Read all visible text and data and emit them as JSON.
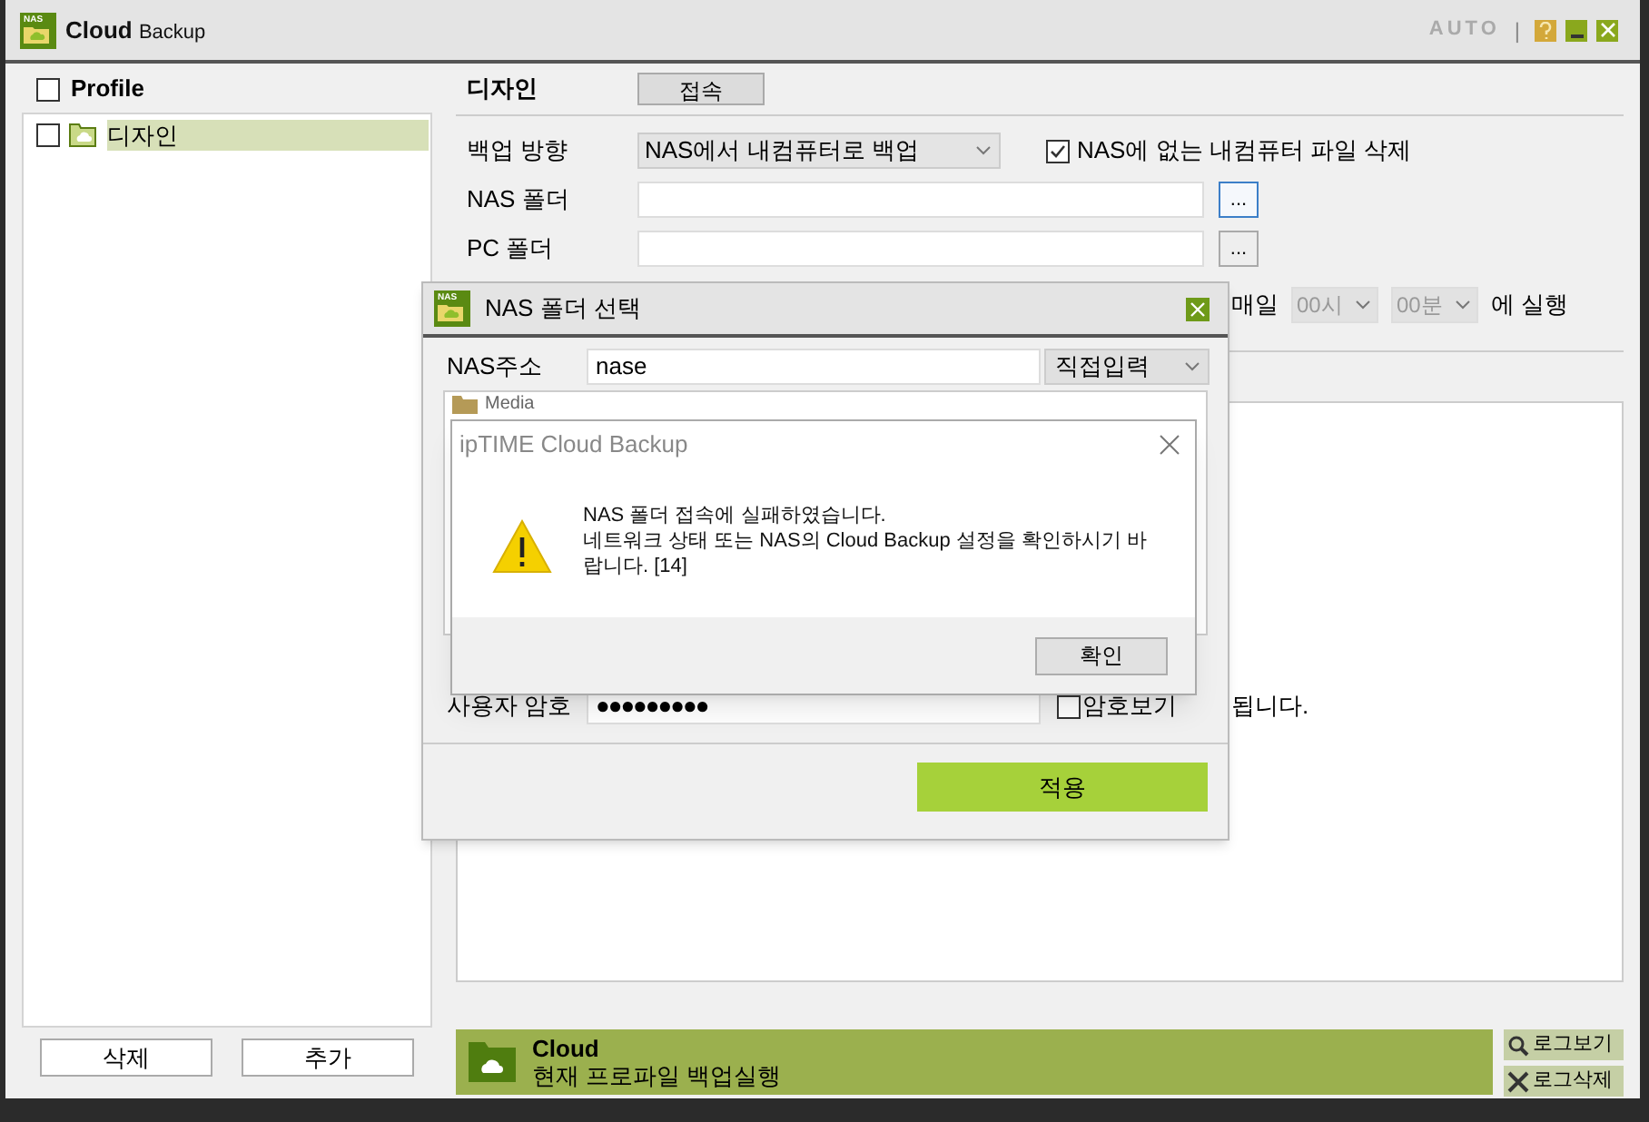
{
  "window": {
    "logo_text": "NAS",
    "title_bold": "Cloud",
    "title_rest": "Backup",
    "auto_label": "AUTO",
    "separator": "|"
  },
  "profiles": {
    "header": "Profile",
    "header_checked": false,
    "items": [
      {
        "label": "디자인",
        "checked": false,
        "selected": true
      }
    ],
    "buttons": [
      "삭제",
      "추가"
    ]
  },
  "detail": {
    "name": "디자인",
    "connect_button": "접속",
    "direction_label": "백업 방향",
    "direction_value": "NAS에서 내컴퓨터로 백업",
    "delete_option": {
      "label": "NAS에 없는 내컴퓨터 파일 삭제",
      "checked": true
    },
    "nas_folder_label": "NAS 폴더",
    "pc_folder_label": "PC 폴더",
    "browse_button": "...",
    "schedule": {
      "every_label": "매일",
      "hour": "00시",
      "minute": "00분",
      "suffix": "에 실행"
    },
    "log_fragment": "됩니다."
  },
  "status_bar": {
    "title": "Cloud",
    "subtitle": "현재 프로파일 백업실행",
    "buttons": [
      {
        "kind": "view",
        "label": "로그보기"
      },
      {
        "kind": "delete",
        "label": "로그삭제"
      }
    ]
  },
  "nas_dialog": {
    "logo_text": "NAS",
    "title": "NAS 폴더 선택",
    "address_label": "NAS주소",
    "address_value": "nase",
    "address_mode": "직접입력",
    "folders": [
      {
        "label": "Media"
      }
    ],
    "password_label": "사용자 암호",
    "password_value": "●●●●●●●●●",
    "show_password": {
      "label": "암호보기",
      "checked": false
    },
    "apply_button": "적용"
  },
  "message_box": {
    "title": "ipTIME Cloud Backup",
    "lines": [
      "NAS 폴더 접속에 실패하였습니다.",
      "네트워크 상태 또는 NAS의 Cloud Backup 설정을 확인하시기 바",
      "랍니다. [14]"
    ],
    "ok_button": "확인"
  }
}
